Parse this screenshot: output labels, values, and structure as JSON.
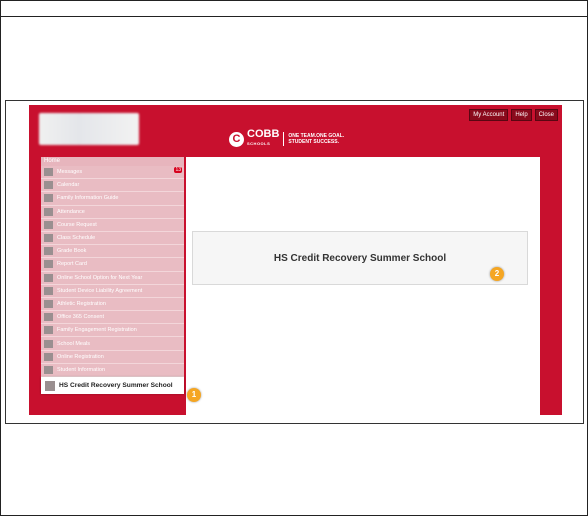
{
  "window": {
    "topbar_buttons": [
      "My Account",
      "Help",
      "Close"
    ]
  },
  "logo": {
    "letter": "C",
    "name": "COBB",
    "subname": "SCHOOLS",
    "tagline_1": "ONE TEAM.ONE GOAL.",
    "tagline_2": "STUDENT SUCCESS."
  },
  "sidebar": {
    "home": "Home",
    "items": [
      {
        "label": "Messages",
        "icon": "envelope-icon",
        "badge": "13"
      },
      {
        "label": "Calendar",
        "icon": "calendar-icon"
      },
      {
        "label": "Family Information Guide",
        "icon": "people-icon"
      },
      {
        "label": "Attendance",
        "icon": "checklist-icon"
      },
      {
        "label": "Course Request",
        "icon": "calendar-icon"
      },
      {
        "label": "Class Schedule",
        "icon": "schedule-icon"
      },
      {
        "label": "Grade Book",
        "icon": "gradebook-icon"
      },
      {
        "label": "Report Card",
        "icon": "report-card-icon"
      },
      {
        "label": "Online School Option for Next Year",
        "icon": "people-icon"
      },
      {
        "label": "Student Device Liability Agreement",
        "icon": "people-icon"
      },
      {
        "label": "Athletic Registration",
        "icon": "people-icon"
      },
      {
        "label": "Office 365 Consent",
        "icon": "people-icon"
      },
      {
        "label": "Family Engagement Registration",
        "icon": "people-icon"
      },
      {
        "label": "School Meals",
        "icon": "people-icon"
      },
      {
        "label": "Online Registration",
        "icon": "people-icon"
      },
      {
        "label": "Student Information",
        "icon": "people-icon"
      }
    ],
    "active": {
      "label": "HS Credit Recovery Summer School",
      "icon": "people-icon"
    }
  },
  "main": {
    "card_title": "HS Credit Recovery Summer School"
  },
  "callouts": [
    "1",
    "2"
  ],
  "colors": {
    "brand_red": "#c8102e",
    "callout_orange": "#f5a623"
  }
}
